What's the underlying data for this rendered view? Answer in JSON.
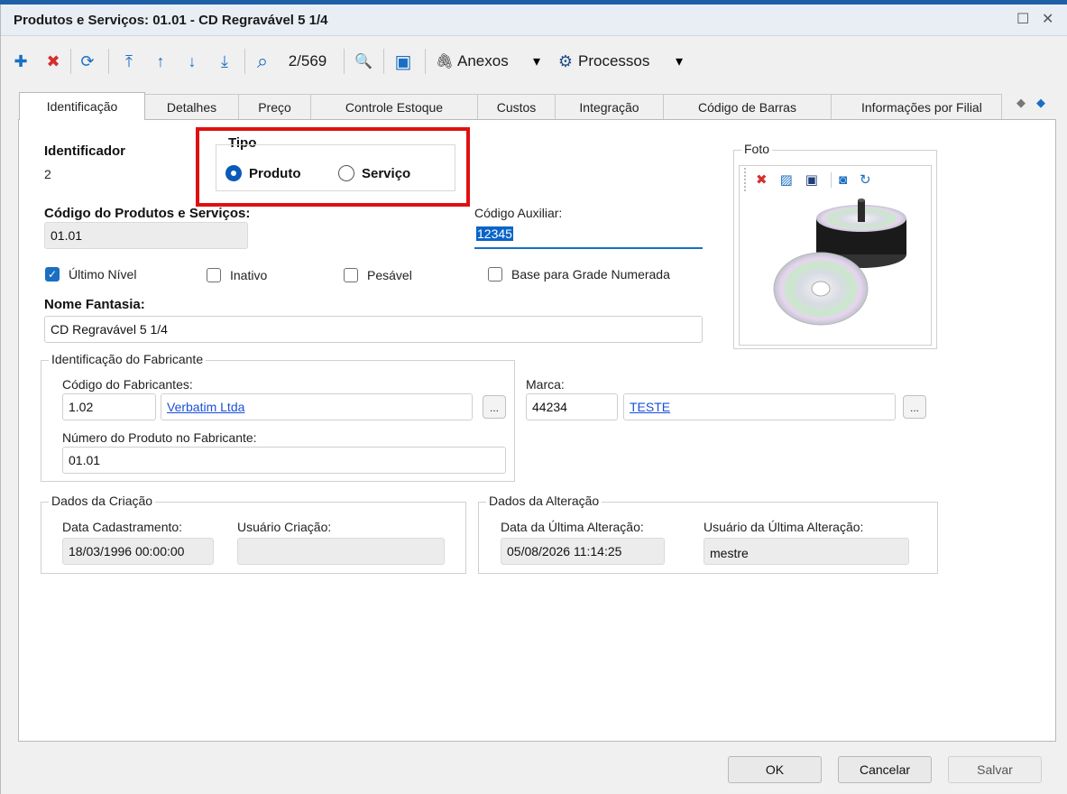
{
  "window": {
    "title": "Produtos e Serviços: 01.01 - CD Regravável 5 1/4",
    "maximize_glyph": "☐",
    "close_glyph": "✕"
  },
  "toolbar": {
    "record_counter": "2/569",
    "attachments_label": "Anexos",
    "processes_label": "Processos",
    "glyphs": {
      "add": "✚",
      "delete": "✖",
      "refresh": "⟳",
      "first": "⤒",
      "prev": "↑",
      "next": "↓",
      "last": "⤓",
      "search": "⌕",
      "zoom": "🔍",
      "monitor": "▣",
      "clip": "🖇",
      "gear": "⚙",
      "dropdown": "▾"
    }
  },
  "tabs": [
    {
      "label": "Identificação",
      "active": true
    },
    {
      "label": "Detalhes"
    },
    {
      "label": "Preço"
    },
    {
      "label": "Controle Estoque"
    },
    {
      "label": "Custos"
    },
    {
      "label": "Integração"
    },
    {
      "label": "Código de Barras"
    },
    {
      "label": "Informações por Filial"
    }
  ],
  "tab_nav": {
    "left": "◆",
    "right": "◆"
  },
  "identificador": {
    "label": "Identificador",
    "value": "2"
  },
  "tipo": {
    "label": "Tipo",
    "options": [
      {
        "label": "Produto",
        "selected": true
      },
      {
        "label": "Serviço",
        "selected": false
      }
    ]
  },
  "codigo_produto": {
    "label": "Código do Produtos e Serviços:",
    "value": "01.01"
  },
  "codigo_auxiliar": {
    "label": "Código Auxiliar:",
    "value": "12345"
  },
  "checkboxes": [
    {
      "label": "Último Nível",
      "checked": true
    },
    {
      "label": "Inativo",
      "checked": false
    },
    {
      "label": "Pesável",
      "checked": false
    },
    {
      "label": "Base para Grade Numerada",
      "checked": false
    }
  ],
  "check_glyph": "✓",
  "nome_fantasia": {
    "label": "Nome Fantasia:",
    "value": "CD Regravável 5 1/4"
  },
  "foto": {
    "label": "Foto"
  },
  "fabricante": {
    "legend": "Identificação do Fabricante",
    "codigo_label": "Código do Fabricantes:",
    "codigo_value": "1.02",
    "nome_value": "Verbatim Ltda",
    "numero_label": "Número do Produto no Fabricante:",
    "numero_value": "01.01",
    "marca_label": "Marca:",
    "marca_codigo": "44234",
    "marca_nome": "TESTE",
    "ellipsis": "..."
  },
  "criacao": {
    "legend": "Dados da Criação",
    "data_label": "Data Cadastramento:",
    "data_value": "18/03/1996 00:00:00",
    "usuario_label": "Usuário Criação:",
    "usuario_value": ""
  },
  "alteracao": {
    "legend": "Dados da Alteração",
    "data_label": "Data da Última Alteração:",
    "data_value": "05/08/2026 11:14:25",
    "usuario_label": "Usuário da Última Alteração:",
    "usuario_value": "mestre"
  },
  "buttons": {
    "ok": "OK",
    "cancel": "Cancelar",
    "save": "Salvar"
  },
  "colors": {
    "accent": "#1a6fc2",
    "highlight": "#e01010",
    "delete": "#d32f2f"
  }
}
